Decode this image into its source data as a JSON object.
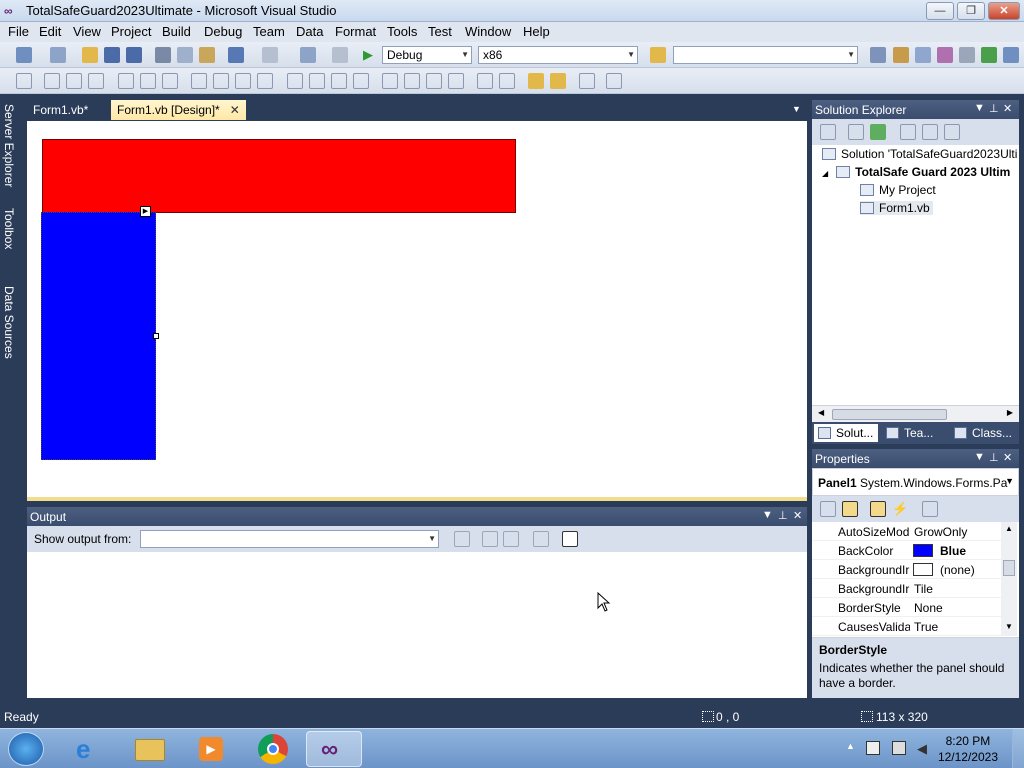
{
  "window": {
    "title": "TotalSafeGuard2023Ultimate - Microsoft Visual Studio",
    "minimize": "—",
    "maximize": "❐",
    "close": "✕"
  },
  "menu": [
    "File",
    "Edit",
    "View",
    "Project",
    "Build",
    "Debug",
    "Team",
    "Data",
    "Format",
    "Tools",
    "Test",
    "Window",
    "Help"
  ],
  "toolbar": {
    "config": "Debug",
    "platform": "x86",
    "find_value": ""
  },
  "side_strip": [
    "Server Explorer",
    "Toolbox",
    "Data Sources"
  ],
  "doc_tabs": [
    {
      "label": "Form1.vb*",
      "active": false
    },
    {
      "label": "Form1.vb [Design]*",
      "active": true
    }
  ],
  "designer": {
    "panel_top_color": "#ff0000",
    "panel_left_color": "#0000ff"
  },
  "output": {
    "title": "Output",
    "show_from_label": "Show output from:",
    "show_from_value": ""
  },
  "solution_explorer": {
    "title": "Solution Explorer",
    "tree": [
      {
        "label": "Solution 'TotalSafeGuard2023Ulti",
        "level": 0,
        "bold": false
      },
      {
        "label": "TotalSafe Guard 2023 Ultim",
        "level": 1,
        "bold": true
      },
      {
        "label": "My Project",
        "level": 2,
        "bold": false
      },
      {
        "label": "Form1.vb",
        "level": 2,
        "bold": false
      }
    ],
    "tabs": [
      "Solut...",
      "Tea...",
      "Class..."
    ]
  },
  "properties": {
    "title": "Properties",
    "object_name": "Panel1",
    "object_type": "System.Windows.Forms.Pa",
    "rows": [
      {
        "name": "AutoSizeMod",
        "value": "GrowOnly"
      },
      {
        "name": "BackColor",
        "value": "Blue",
        "swatch": "#0000ff"
      },
      {
        "name": "BackgroundIr",
        "value": "(none)",
        "swatch": "#ffffff"
      },
      {
        "name": "BackgroundIr",
        "value": "Tile"
      },
      {
        "name": "BorderStyle",
        "value": "None"
      },
      {
        "name": "CausesValidat",
        "value": "True"
      }
    ],
    "desc_title": "BorderStyle",
    "desc_text": "Indicates whether the panel should have a border."
  },
  "status": {
    "text": "Ready",
    "position": "0 , 0",
    "size": "113 x 320"
  },
  "taskbar": {
    "time": "8:20 PM",
    "date": "12/12/2023"
  }
}
